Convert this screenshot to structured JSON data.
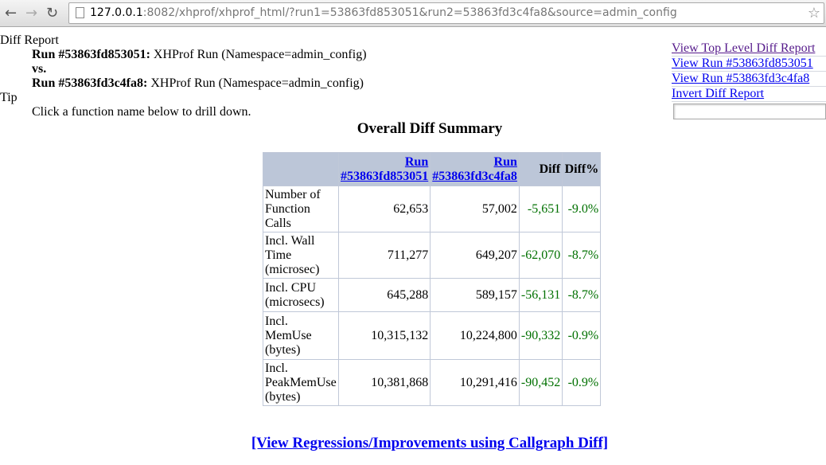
{
  "browser": {
    "url_host": "127.0.0.1",
    "url_rest": ":8082/xhprof/xhprof_html/?run1=53863fd853051&run2=53863fd3c4fa8&source=admin_config"
  },
  "header": {
    "title": "Diff Report",
    "run1_label": "Run #53863fd853051:",
    "run1_desc": " XHProf Run (Namespace=admin_config)",
    "vs": "vs.",
    "run2_label": "Run #53863fd3c4fa8:",
    "run2_desc": " XHProf Run (Namespace=admin_config)",
    "tip_title": "Tip",
    "tip_text": "Click a function name below to drill down."
  },
  "links": [
    "View Top Level Diff Report",
    "View Run #53863fd853051",
    "View Run #53863fd3c4fa8",
    "Invert Diff Report"
  ],
  "summary": {
    "title": "Overall Diff Summary",
    "columns": [
      "",
      "Run #53863fd853051",
      "Run #53863fd3c4fa8",
      "Diff",
      "Diff%"
    ],
    "run_link_prefix": "Run",
    "run1_id": "#53863fd853051",
    "run2_id": "#53863fd3c4fa8",
    "rows": [
      {
        "metric": "Number of Function Calls",
        "run1": "62,653",
        "run2": "57,002",
        "diff": "-5,651",
        "pct": "-9.0%"
      },
      {
        "metric": "Incl. Wall Time (microsec)",
        "run1": "711,277",
        "run2": "649,207",
        "diff": "-62,070",
        "pct": "-8.7%"
      },
      {
        "metric": "Incl. CPU (microsecs)",
        "run1": "645,288",
        "run2": "589,157",
        "diff": "-56,131",
        "pct": "-8.7%"
      },
      {
        "metric": "Incl. MemUse (bytes)",
        "run1": "10,315,132",
        "run2": "10,224,800",
        "diff": "-90,332",
        "pct": "-0.9%"
      },
      {
        "metric": "Incl. PeakMemUse (bytes)",
        "run1": "10,381,868",
        "run2": "10,291,416",
        "diff": "-90,452",
        "pct": "-0.9%"
      }
    ]
  },
  "callgraph_link": "[View Regressions/Improvements using Callgraph Diff]"
}
